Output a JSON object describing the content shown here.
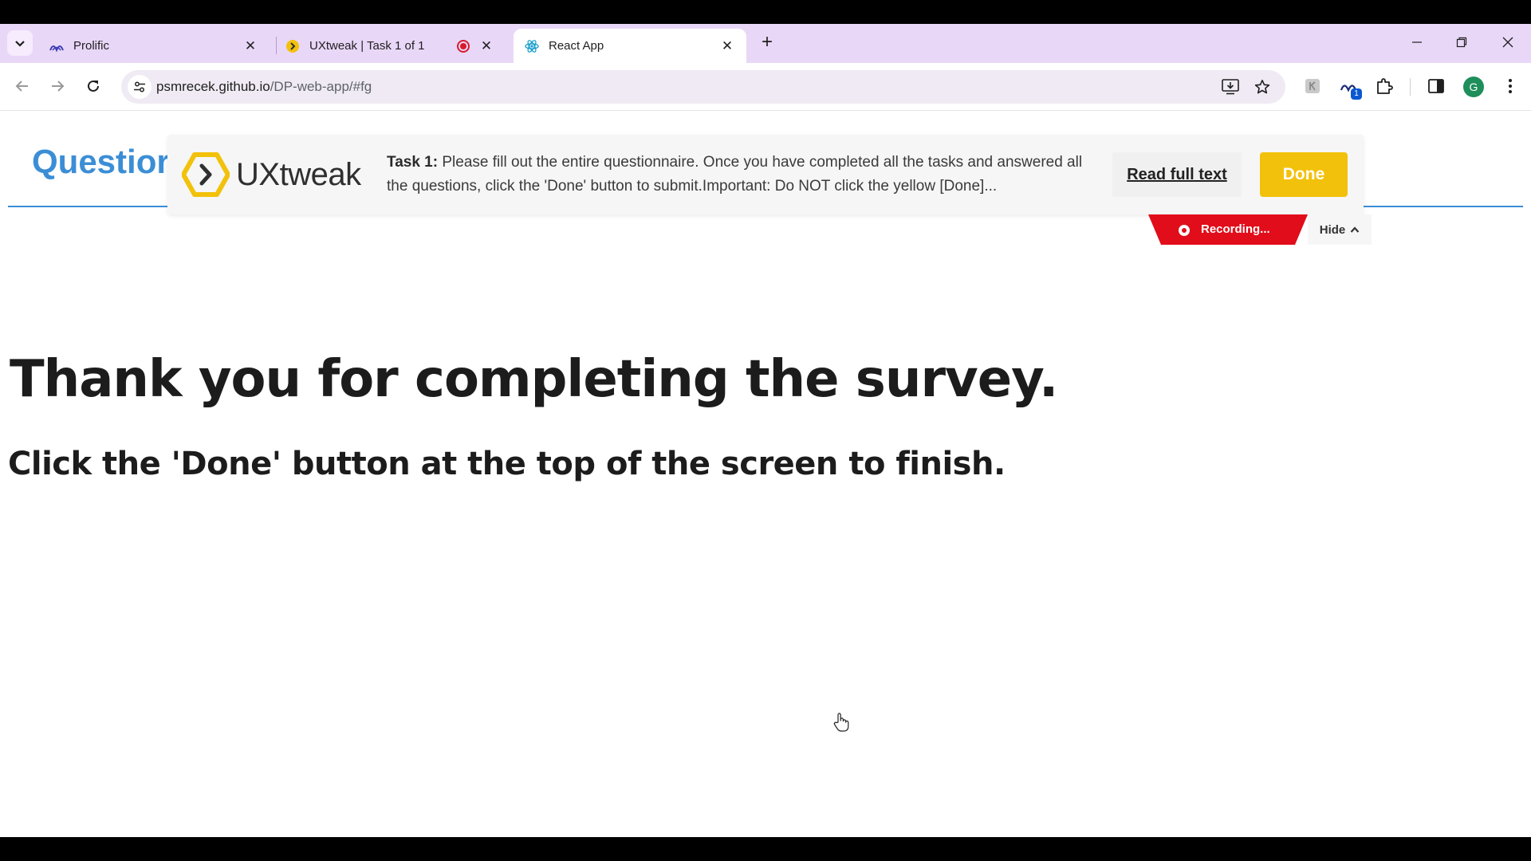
{
  "browser": {
    "tabs": [
      {
        "title": "Prolific",
        "icon": "prolific-icon"
      },
      {
        "title": "UXtweak | Task 1 of 1",
        "icon": "uxtweak-icon",
        "recording": true
      },
      {
        "title": "React App",
        "icon": "react-icon",
        "active": true
      }
    ],
    "new_tab_label": "+",
    "address": {
      "host": "psmrecek.github.io",
      "path": "/DP-web-app/#fg"
    },
    "profile_initial": "G",
    "extension_badge": "1"
  },
  "page": {
    "header_title": "Questior",
    "thank_heading": "Thank you for completing the survey.",
    "instruction": "Click the 'Done' button at the top of the screen to finish."
  },
  "uxtweak": {
    "logo_word_ux": "UX",
    "logo_word_tweak": "tweak",
    "task_label": "Task 1:",
    "task_text": "Please fill out the entire questionnaire. Once you have completed all the tasks and answered all the questions, click the 'Done' button to submit.Important: Do NOT click the yellow [Done]...",
    "read_full_label": "Read full text",
    "done_label": "Done",
    "recording_label": "Recording...",
    "hide_label": "Hide"
  },
  "colors": {
    "tabstrip": "#e9d7f8",
    "header_accent": "#3b8ed6",
    "done_yellow": "#f2c10b",
    "recording_red": "#e10d1a"
  }
}
